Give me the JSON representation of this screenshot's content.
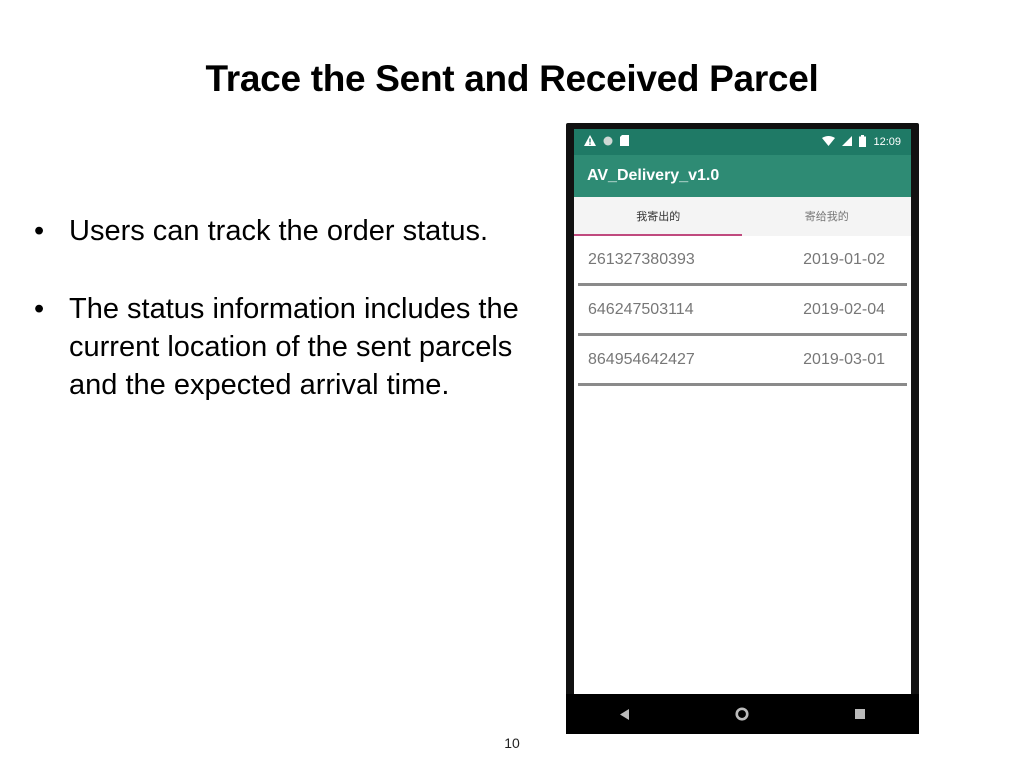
{
  "slide": {
    "title": "Trace the Sent and Received Parcel",
    "bullet_symbol": "•",
    "bullets": [
      "Users can track the order status.",
      "The status information includes the current location of the sent parcels and the expected arrival time."
    ],
    "page_number": "10"
  },
  "phone": {
    "status_bar": {
      "time": "12:09",
      "left_icons": [
        "warning-icon",
        "circle-icon",
        "sd-card-icon"
      ],
      "right_icons": [
        "wifi-icon",
        "signal-icon",
        "battery-icon"
      ]
    },
    "app_title": "AV_Delivery_v1.0",
    "tabs": [
      {
        "label": "我寄出的",
        "selected": true
      },
      {
        "label": "寄给我的",
        "selected": false
      }
    ],
    "parcels": [
      {
        "tracking_number": "261327380393",
        "date": "2019-01-02"
      },
      {
        "tracking_number": "646247503114",
        "date": "2019-02-04"
      },
      {
        "tracking_number": "864954642427",
        "date": "2019-03-01"
      }
    ],
    "nav_buttons": [
      "back-icon",
      "home-icon",
      "recents-icon"
    ],
    "colors": {
      "status_bar": "#1f7a66",
      "app_bar": "#2e8b74",
      "tab_indicator": "#c04a7e"
    }
  }
}
